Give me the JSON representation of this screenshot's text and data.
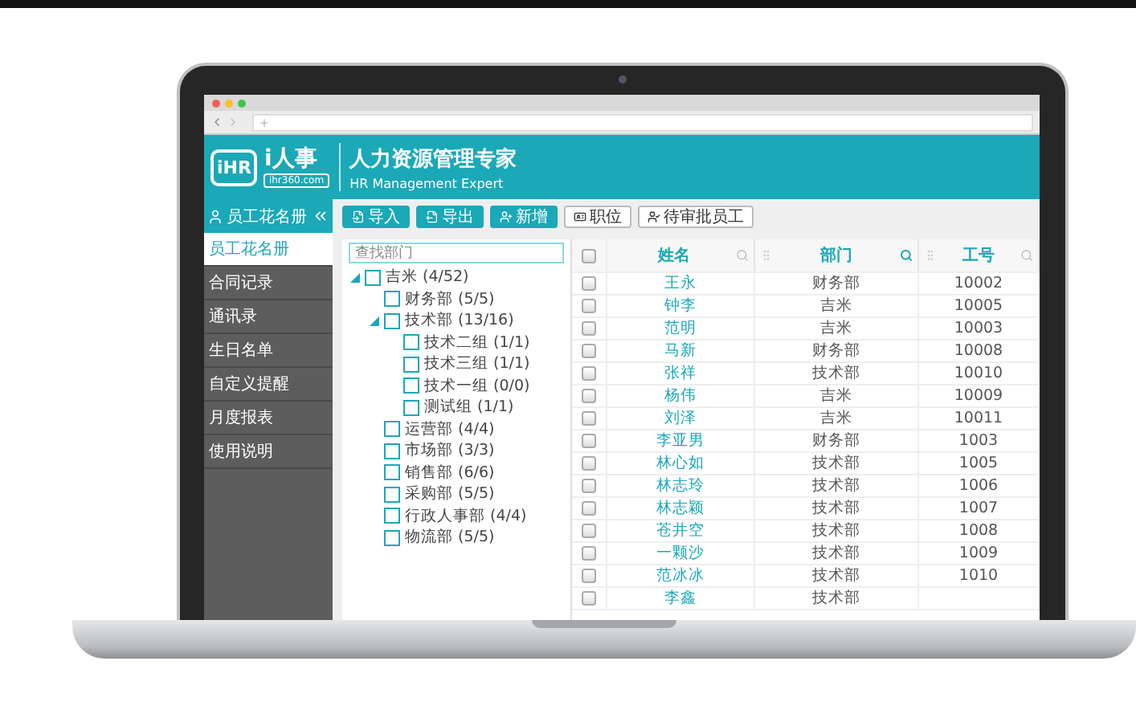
{
  "header": {
    "logo_mark": "iHR",
    "logo_name": "i人事",
    "logo_site": "ihr360.com",
    "title": "人力资源管理专家",
    "subtitle": "HR Management Expert"
  },
  "sidebar": {
    "title": "员工花名册",
    "items": [
      {
        "label": "员工花名册",
        "selected": true
      },
      {
        "label": "合同记录",
        "selected": false
      },
      {
        "label": "通讯录",
        "selected": false
      },
      {
        "label": "生日名单",
        "selected": false
      },
      {
        "label": "自定义提醒",
        "selected": false
      },
      {
        "label": "月度报表",
        "selected": false
      },
      {
        "label": "使用说明",
        "selected": false
      }
    ]
  },
  "toolbar": [
    {
      "label": "导入",
      "kind": "primary"
    },
    {
      "label": "导出",
      "kind": "primary"
    },
    {
      "label": "新增",
      "kind": "primary"
    },
    {
      "label": "职位",
      "kind": "plain"
    },
    {
      "label": "待审批员工",
      "kind": "plain"
    }
  ],
  "tree": {
    "placeholder": "查找部门",
    "nodes": [
      {
        "label": "吉米 (4/52)",
        "checked": false,
        "expanded": true,
        "children": [
          {
            "label": "财务部 (5/5)",
            "checked": false
          },
          {
            "label": "技术部 (13/16)",
            "checked": false,
            "expanded": true,
            "children": [
              {
                "label": "技术二组 (1/1)",
                "checked": false
              },
              {
                "label": "技术三组 (1/1)",
                "checked": false
              },
              {
                "label": "技术一组 (0/0)",
                "checked": false
              },
              {
                "label": "测试组 (1/1)",
                "checked": false
              }
            ]
          },
          {
            "label": "运营部 (4/4)",
            "checked": false
          },
          {
            "label": "市场部 (3/3)",
            "checked": false
          },
          {
            "label": "销售部 (6/6)",
            "checked": false
          },
          {
            "label": "采购部 (5/5)",
            "checked": false
          },
          {
            "label": "行政人事部 (4/4)",
            "checked": false
          },
          {
            "label": "物流部 (5/5)",
            "checked": false
          }
        ]
      }
    ]
  },
  "table": {
    "all_checked": false,
    "columns": [
      {
        "label": "姓名",
        "filtered": false
      },
      {
        "label": "部门",
        "filtered": true
      },
      {
        "label": "工号",
        "filtered": false
      }
    ],
    "rows": [
      {
        "checked": false,
        "cells": [
          "王永",
          "财务部",
          "10002"
        ]
      },
      {
        "checked": false,
        "cells": [
          "钟李",
          "吉米",
          "10005"
        ]
      },
      {
        "checked": false,
        "cells": [
          "范明",
          "吉米",
          "10003"
        ]
      },
      {
        "checked": false,
        "cells": [
          "马新",
          "财务部",
          "10008"
        ]
      },
      {
        "checked": false,
        "cells": [
          "张祥",
          "技术部",
          "10010"
        ]
      },
      {
        "checked": false,
        "cells": [
          "杨伟",
          "吉米",
          "10009"
        ]
      },
      {
        "checked": false,
        "cells": [
          "刘泽",
          "吉米",
          "10011"
        ]
      },
      {
        "checked": false,
        "cells": [
          "李亚男",
          "财务部",
          "1003"
        ]
      },
      {
        "checked": false,
        "cells": [
          "林心如",
          "技术部",
          "1005"
        ]
      },
      {
        "checked": false,
        "cells": [
          "林志玲",
          "技术部",
          "1006"
        ]
      },
      {
        "checked": false,
        "cells": [
          "林志颖",
          "技术部",
          "1007"
        ]
      },
      {
        "checked": false,
        "cells": [
          "苍井空",
          "技术部",
          "1008"
        ]
      },
      {
        "checked": false,
        "cells": [
          "一颗沙",
          "技术部",
          "1009"
        ]
      },
      {
        "checked": false,
        "cells": [
          "范冰冰",
          "技术部",
          "1010"
        ]
      },
      {
        "checked": false,
        "cells": [
          "李鑫",
          "技术部"
        ]
      }
    ]
  }
}
